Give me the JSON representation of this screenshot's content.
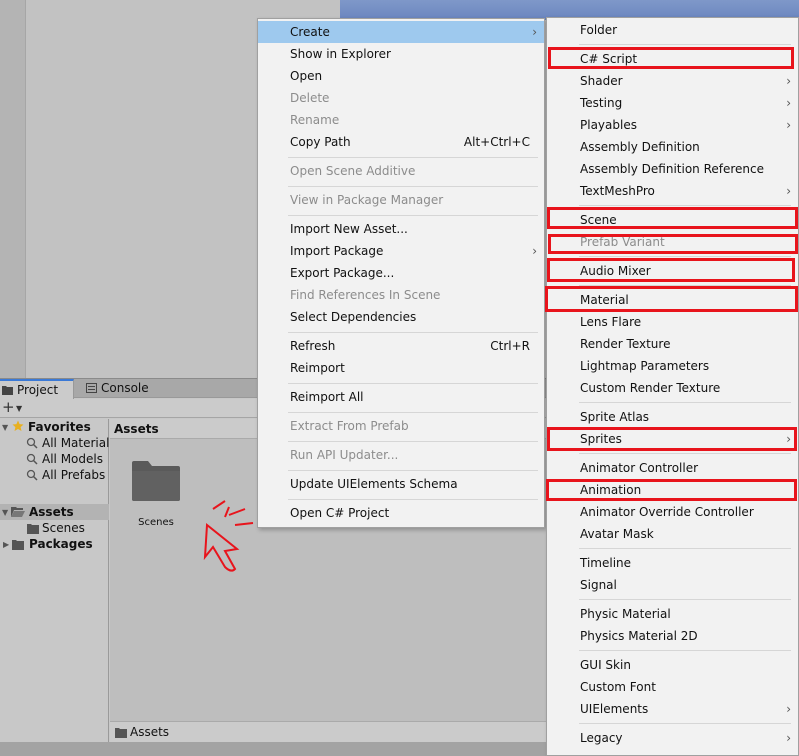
{
  "project_window": {
    "tabs": {
      "project": "Project",
      "console": "Console"
    },
    "plus_label": "+",
    "tree": {
      "favorites": "Favorites",
      "all_materials": "All Materials",
      "all_models": "All Models",
      "all_prefabs": "All Prefabs",
      "assets": "Assets",
      "scenes": "Scenes",
      "packages": "Packages"
    },
    "assets_header": "Assets",
    "folder_scenes": "Scenes",
    "footer_path": "Assets"
  },
  "main_menu": {
    "create": "Create",
    "show_in_explorer": "Show in Explorer",
    "open": "Open",
    "delete": "Delete",
    "rename": "Rename",
    "copy_path": "Copy Path",
    "copy_path_shortcut": "Alt+Ctrl+C",
    "open_scene_additive": "Open Scene Additive",
    "view_in_package_manager": "View in Package Manager",
    "import_new_asset": "Import New Asset...",
    "import_package": "Import Package",
    "export_package": "Export Package...",
    "find_references": "Find References In Scene",
    "select_dependencies": "Select Dependencies",
    "refresh": "Refresh",
    "refresh_shortcut": "Ctrl+R",
    "reimport": "Reimport",
    "reimport_all": "Reimport All",
    "extract_from_prefab": "Extract From Prefab",
    "run_api_updater": "Run API Updater...",
    "update_uielements_schema": "Update UIElements Schema",
    "open_csharp_project": "Open C# Project"
  },
  "create_menu": {
    "folder": "Folder",
    "csharp_script": "C# Script",
    "shader": "Shader",
    "testing": "Testing",
    "playables": "Playables",
    "assembly_definition": "Assembly Definition",
    "assembly_definition_reference": "Assembly Definition Reference",
    "textmeshpro": "TextMeshPro",
    "scene": "Scene",
    "prefab_variant": "Prefab Variant",
    "audio_mixer": "Audio Mixer",
    "material": "Material",
    "lens_flare": "Lens Flare",
    "render_texture": "Render Texture",
    "lightmap_parameters": "Lightmap Parameters",
    "custom_render_texture": "Custom Render Texture",
    "sprite_atlas": "Sprite Atlas",
    "sprites": "Sprites",
    "animator_controller": "Animator Controller",
    "animation": "Animation",
    "animator_override_controller": "Animator Override Controller",
    "avatar_mask": "Avatar Mask",
    "timeline": "Timeline",
    "signal": "Signal",
    "physic_material": "Physic Material",
    "physics_material_2d": "Physics Material 2D",
    "gui_skin": "GUI Skin",
    "custom_font": "Custom Font",
    "uielements": "UIElements",
    "legacy": "Legacy"
  },
  "submenu_arrow": "›",
  "colors": {
    "highlight": "#9ec9ee",
    "annotation_red": "#e8141c",
    "disabled_text": "#8c8c8c"
  }
}
